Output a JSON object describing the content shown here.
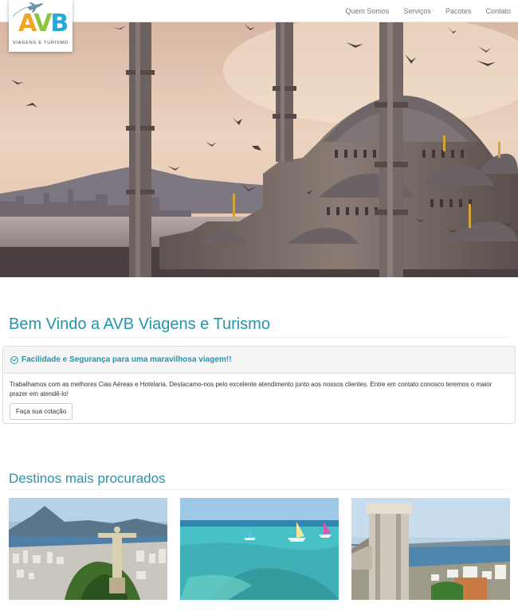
{
  "brand": {
    "logo_letters": "AVB",
    "tagline": "VIAGENS E TURISMO",
    "colors": {
      "a": "#f2a51f",
      "v": "#8cc63f",
      "b": "#29a9d8"
    }
  },
  "nav": {
    "items": [
      {
        "label": "Quem Somos"
      },
      {
        "label": "Serviços"
      },
      {
        "label": "Pacotes"
      },
      {
        "label": "Contato"
      }
    ]
  },
  "carousel": {
    "slide_count": 3,
    "active_index": 2
  },
  "welcome": {
    "title": "Bem Vindo a AVB Viagens e Turismo"
  },
  "panel": {
    "title": "Facilidade e Segurança para uma maravilhosa viagem!!",
    "body": "Trabalhamos com as melhores Cias Aéreas e Hotelaria. Destacamo-nos pelo excelente atendimento junto aos nossos clientes. Entre em contato conosco teremos o maior prazer em atendê-lo!",
    "button_label": "Faça sua cotação"
  },
  "destinations": {
    "title": "Destinos mais procurados"
  },
  "colors": {
    "accent": "#2196b0",
    "nav_text": "#777777"
  }
}
